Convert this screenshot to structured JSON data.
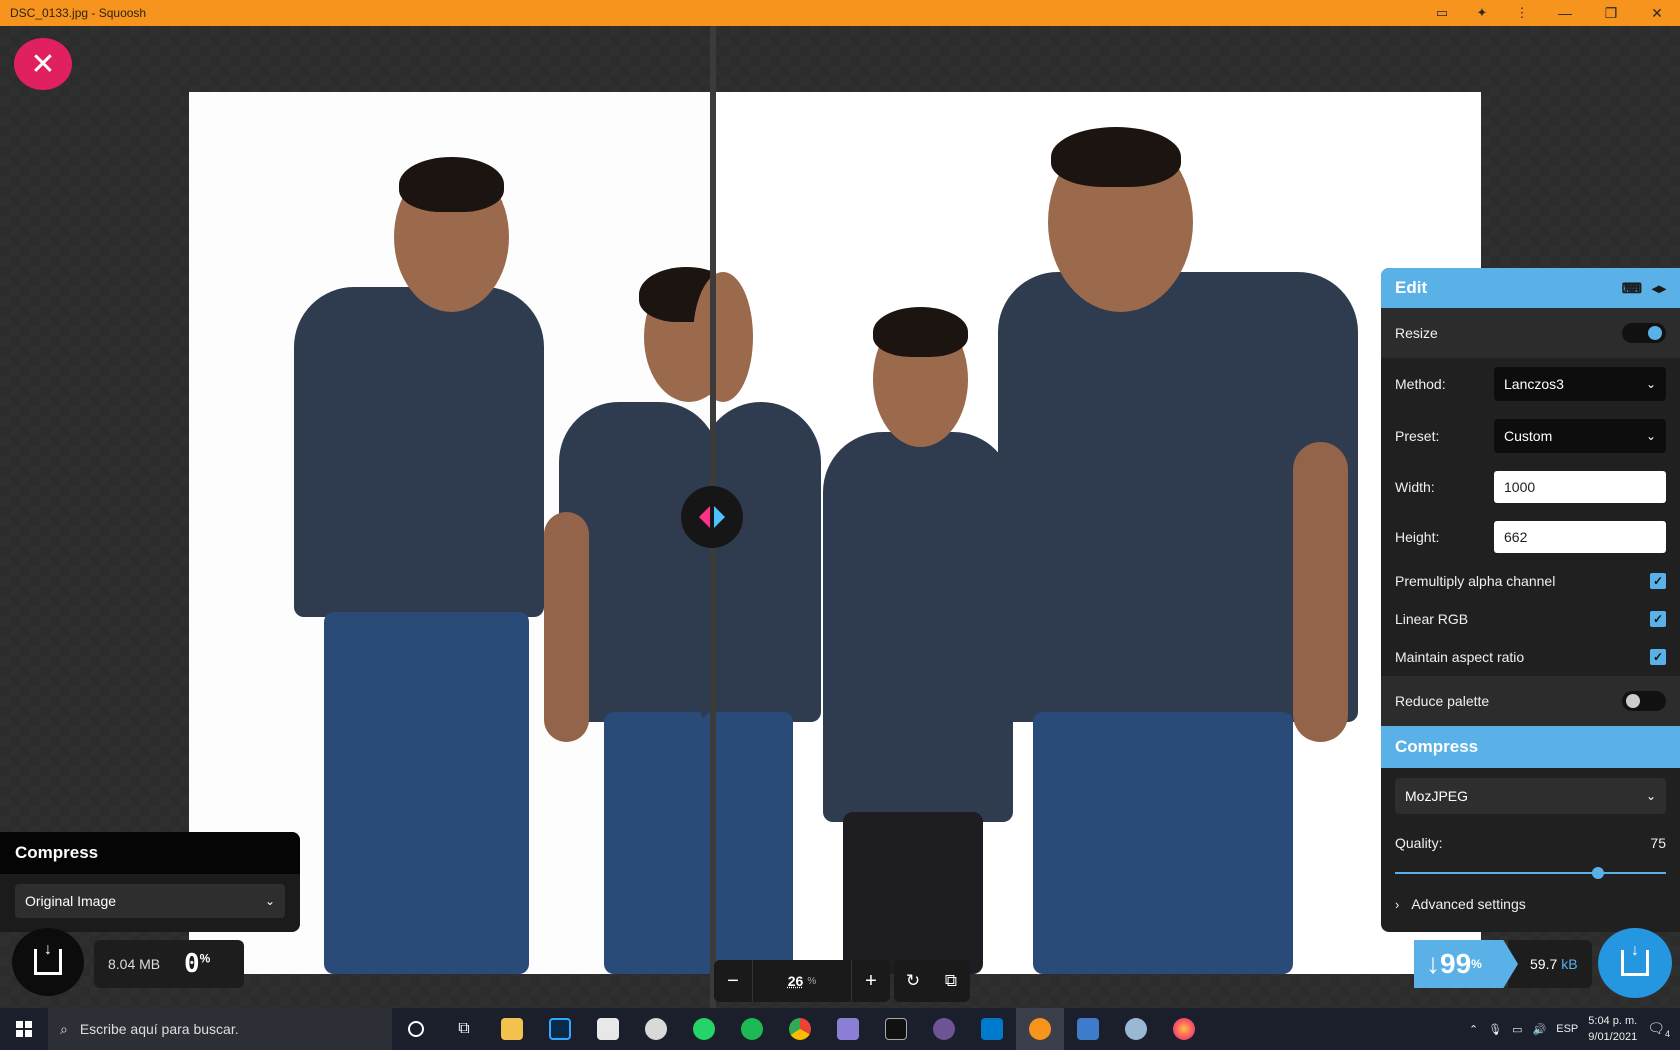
{
  "window": {
    "title": "DSC_0133.jpg - Squoosh"
  },
  "divider": {},
  "left_panel": {
    "header": "Compress",
    "encoder_value": "Original Image",
    "size": "8.04 MB",
    "percent": "0",
    "percent_unit": "%"
  },
  "zoom": {
    "minus": "−",
    "value": "26",
    "unit": "%",
    "plus": "+"
  },
  "edit_panel": {
    "header": "Edit",
    "resize_label": "Resize",
    "resize_on": true,
    "method_label": "Method:",
    "method_value": "Lanczos3",
    "preset_label": "Preset:",
    "preset_value": "Custom",
    "width_label": "Width:",
    "width_value": "1000",
    "height_label": "Height:",
    "height_value": "662",
    "premultiply_label": "Premultiply alpha channel",
    "linear_rgb_label": "Linear RGB",
    "aspect_label": "Maintain aspect ratio",
    "reduce_palette_label": "Reduce palette",
    "reduce_palette_on": false
  },
  "compress_panel": {
    "header": "Compress",
    "encoder_value": "MozJPEG",
    "quality_label": "Quality:",
    "quality_value": "75",
    "quality_fraction": 0.75,
    "advanced_label": "Advanced settings"
  },
  "result": {
    "arrow": "↓",
    "percent": "99",
    "percent_unit": "%",
    "size": "59.7",
    "size_unit": "kB"
  },
  "taskbar": {
    "search_placeholder": "Escribe aquí para buscar.",
    "lang": "ESP",
    "time": "5:04 p. m.",
    "date": "9/01/2021",
    "notifications": "4"
  },
  "colors": {
    "titlebar": "#f7941d",
    "accent": "#5ab1e8",
    "close": "#e0205f",
    "left_handle": "#ff3385",
    "right_handle": "#4cc3ff"
  }
}
